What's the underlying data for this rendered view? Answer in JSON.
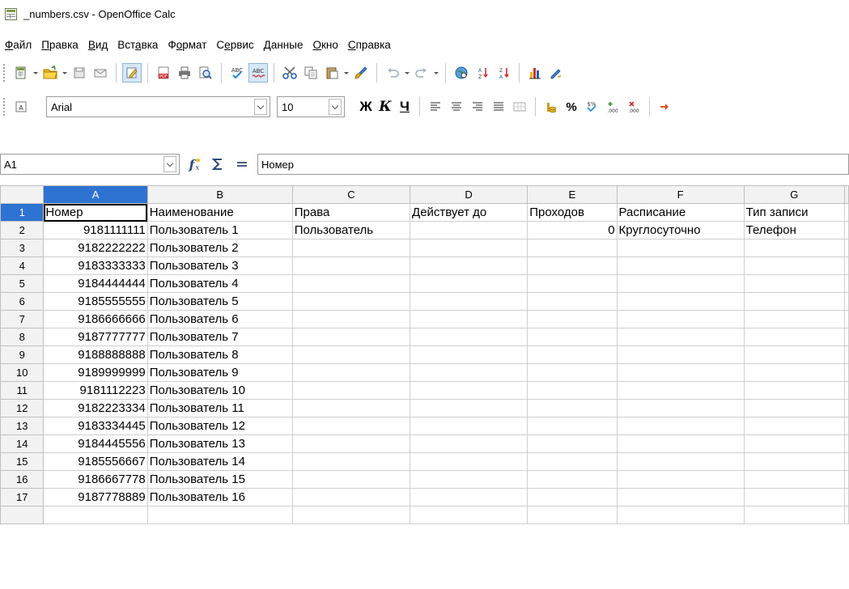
{
  "window": {
    "title": "_numbers.csv - OpenOffice Calc"
  },
  "menu": [
    {
      "mnemonic": "Ф",
      "rest": "айл"
    },
    {
      "mnemonic": "П",
      "rest": "равка"
    },
    {
      "mnemonic": "В",
      "rest": "ид"
    },
    {
      "pre": "Вст",
      "mnemonic": "а",
      "rest": "вка"
    },
    {
      "pre": "Ф",
      "mnemonic": "о",
      "rest": "рмат"
    },
    {
      "pre": "С",
      "mnemonic": "е",
      "rest": "рвис"
    },
    {
      "mnemonic": "Д",
      "rest": "анные"
    },
    {
      "mnemonic": "О",
      "rest": "кно"
    },
    {
      "mnemonic": "С",
      "rest": "правка"
    }
  ],
  "format_bar": {
    "font_name": "Arial",
    "font_size": "10",
    "bold_glyph": "Ж",
    "italic_glyph": "К",
    "underline_glyph": "Ч",
    "percent_glyph": "%"
  },
  "formula_bar": {
    "cell_ref": "A1",
    "content": "Номер"
  },
  "sheet": {
    "columns": [
      "A",
      "B",
      "C",
      "D",
      "E",
      "F",
      "G"
    ],
    "active_column": 0,
    "active_row": 1,
    "rows": [
      {
        "n": "1",
        "cells": [
          "Номер",
          "Наименование",
          "Права",
          "Действует до",
          "Проходов",
          "Расписание",
          "Тип записи"
        ]
      },
      {
        "n": "2",
        "cells": [
          "9181111111",
          "Пользователь 1",
          "Пользователь",
          "",
          "0",
          "Круглосуточно",
          "Телефон"
        ]
      },
      {
        "n": "3",
        "cells": [
          "9182222222",
          "Пользователь 2",
          "",
          "",
          "",
          "",
          ""
        ]
      },
      {
        "n": "4",
        "cells": [
          "9183333333",
          "Пользователь 3",
          "",
          "",
          "",
          "",
          ""
        ]
      },
      {
        "n": "5",
        "cells": [
          "9184444444",
          "Пользователь 4",
          "",
          "",
          "",
          "",
          ""
        ]
      },
      {
        "n": "6",
        "cells": [
          "9185555555",
          "Пользователь 5",
          "",
          "",
          "",
          "",
          ""
        ]
      },
      {
        "n": "7",
        "cells": [
          "9186666666",
          "Пользователь 6",
          "",
          "",
          "",
          "",
          ""
        ]
      },
      {
        "n": "8",
        "cells": [
          "9187777777",
          "Пользователь 7",
          "",
          "",
          "",
          "",
          ""
        ]
      },
      {
        "n": "9",
        "cells": [
          "9188888888",
          "Пользователь 8",
          "",
          "",
          "",
          "",
          ""
        ]
      },
      {
        "n": "10",
        "cells": [
          "9189999999",
          "Пользователь 9",
          "",
          "",
          "",
          "",
          ""
        ]
      },
      {
        "n": "11",
        "cells": [
          "9181112223",
          "Пользователь 10",
          "",
          "",
          "",
          "",
          ""
        ]
      },
      {
        "n": "12",
        "cells": [
          "9182223334",
          "Пользователь 11",
          "",
          "",
          "",
          "",
          ""
        ]
      },
      {
        "n": "13",
        "cells": [
          "9183334445",
          "Пользователь 12",
          "",
          "",
          "",
          "",
          ""
        ]
      },
      {
        "n": "14",
        "cells": [
          "9184445556",
          "Пользователь 13",
          "",
          "",
          "",
          "",
          ""
        ]
      },
      {
        "n": "15",
        "cells": [
          "9185556667",
          "Пользователь 14",
          "",
          "",
          "",
          "",
          ""
        ]
      },
      {
        "n": "16",
        "cells": [
          "9186667778",
          "Пользователь 15",
          "",
          "",
          "",
          "",
          ""
        ]
      },
      {
        "n": "17",
        "cells": [
          "9187778889",
          "Пользователь 16",
          "",
          "",
          "",
          "",
          ""
        ]
      },
      {
        "n": "",
        "cells": [
          "",
          "",
          "",
          "",
          "",
          "",
          ""
        ]
      }
    ]
  },
  "colors": {
    "header_active": "#2e72d2",
    "header_bg": "#f2f2f2",
    "grid_line": "#cfcfcf"
  }
}
